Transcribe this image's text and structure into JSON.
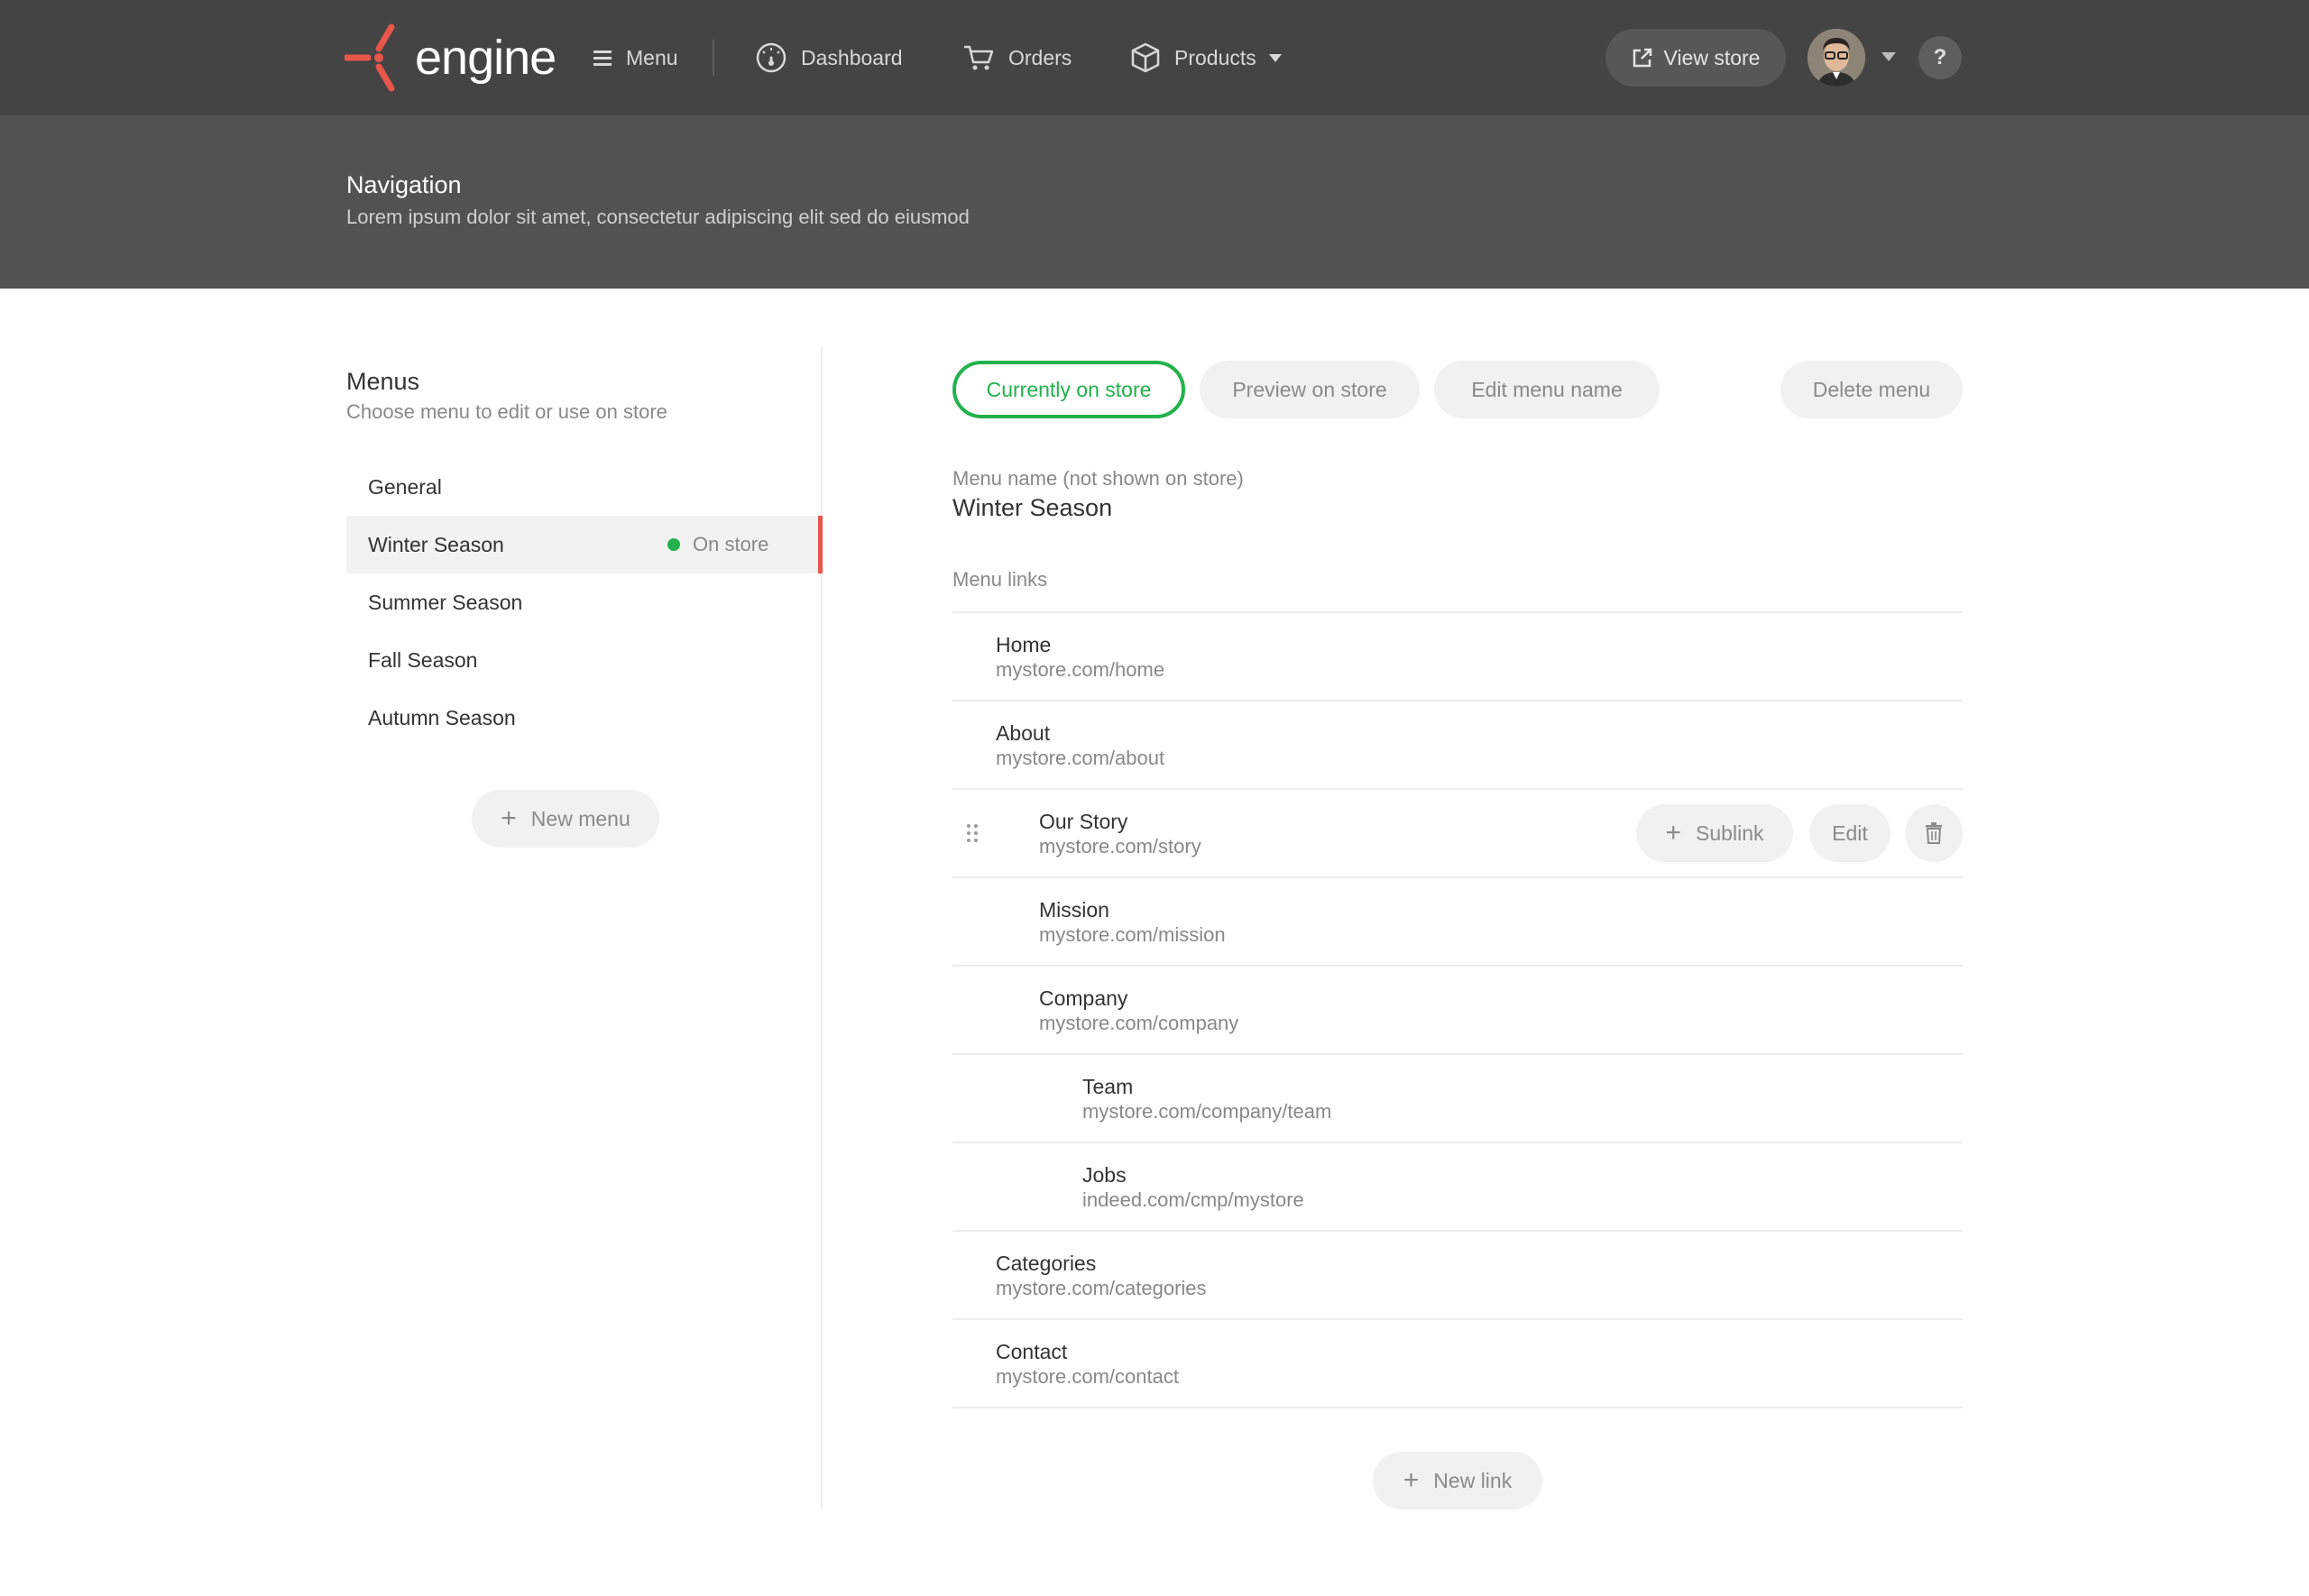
{
  "colors": {
    "accent": "#e8574a",
    "active": "#22b14c",
    "topbar": "#444444",
    "subheader": "#525252"
  },
  "topbar": {
    "logo_text": "engine",
    "nav": [
      {
        "label": "Menu",
        "icon": "hamburger-icon"
      },
      {
        "label": "Dashboard",
        "icon": "gauge-icon"
      },
      {
        "label": "Orders",
        "icon": "cart-icon"
      },
      {
        "label": "Products",
        "icon": "box-icon"
      }
    ],
    "view_store": "View store",
    "help": "?"
  },
  "page": {
    "title": "Navigation",
    "description": "Lorem ipsum dolor sit amet, consectetur adipiscing elit sed do eiusmod"
  },
  "menus": {
    "title": "Menus",
    "subtitle": "Choose menu to edit or use on store",
    "items": [
      {
        "label": "General"
      },
      {
        "label": "Winter Season",
        "status": "On store"
      },
      {
        "label": "Summer Season"
      },
      {
        "label": "Fall Season"
      },
      {
        "label": "Autumn Season"
      }
    ],
    "new_menu": "New menu"
  },
  "editor": {
    "tabs": {
      "current": "Currently on store",
      "preview": "Preview on store",
      "edit_name": "Edit menu name",
      "delete": "Delete menu"
    },
    "name_label": "Menu name (not shown on store)",
    "name_value": "Winter Season",
    "links_label": "Menu links",
    "links": [
      {
        "title": "Home",
        "url": "mystore.com/home"
      },
      {
        "title": "About",
        "url": "mystore.com/about"
      },
      {
        "title": "Our Story",
        "url": "mystore.com/story"
      },
      {
        "title": "Mission",
        "url": "mystore.com/mission"
      },
      {
        "title": "Company",
        "url": "mystore.com/company"
      },
      {
        "title": "Team",
        "url": "mystore.com/company/team"
      },
      {
        "title": "Jobs",
        "url": "indeed.com/cmp/mystore"
      },
      {
        "title": "Categories",
        "url": "mystore.com/categories"
      },
      {
        "title": "Contact",
        "url": "mystore.com/contact"
      }
    ],
    "row_actions": {
      "sublink": "Sublink",
      "edit": "Edit"
    },
    "new_link": "New link"
  }
}
